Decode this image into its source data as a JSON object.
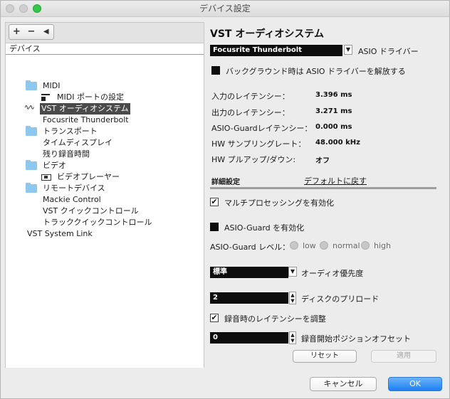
{
  "window": {
    "title": "デバイス設定"
  },
  "toolbar": {
    "add": "+",
    "remove": "−",
    "reset": "◀"
  },
  "tree": {
    "header": "デバイス",
    "items": [
      {
        "label": "MIDI"
      },
      {
        "label": "MIDI ポートの設定"
      },
      {
        "label": "VST オーディオシステム"
      },
      {
        "label": "Focusrite Thunderbolt"
      },
      {
        "label": "トランスポート"
      },
      {
        "label": "タイムディスプレイ"
      },
      {
        "label": "残り録音時間"
      },
      {
        "label": "ビデオ"
      },
      {
        "label": "ビデオプレーヤー"
      },
      {
        "label": "リモートデバイス"
      },
      {
        "label": "Mackie Control"
      },
      {
        "label": "VST クイックコントロール"
      },
      {
        "label": "トラッククイックコントロール"
      },
      {
        "label": "VST System Link"
      }
    ]
  },
  "panel": {
    "title": "VST オーディオシステム",
    "driver_value": "Focusrite Thunderbolt",
    "driver_label": "ASIO ドライバー",
    "background_release": "バックグラウンド時は ASIO ドライバーを解放する",
    "input_latency_label": "入力のレイテンシー：",
    "input_latency_value": "3.396 ms",
    "output_latency_label": "出力のレイテンシー：",
    "output_latency_value": "3.271 ms",
    "asio_guard_latency_label": "ASIO-Guardレイテンシー：",
    "asio_guard_latency_value": "0.000 ms",
    "sample_rate_label": "HW サンプリングレート：",
    "sample_rate_value": "48.000 kHz",
    "pullup_label": "HW プルアップ/ダウン:",
    "pullup_value": "オフ",
    "advanced_label": "詳細設定",
    "defaults_link": "デフォルトに戻す",
    "multiprocessing_label": "マルチプロセッシングを有効化",
    "asio_guard_enable_label": "ASIO-Guard を有効化",
    "asio_guard_level_label": "ASIO-Guard レベル：",
    "level_low": "low",
    "level_normal": "normal",
    "level_high": "high",
    "audio_priority_value": "標準",
    "audio_priority_label": "オーディオ優先度",
    "disk_preload_value": "2",
    "disk_preload_label": "ディスクのプリロード",
    "adjust_latency_label": "録音時のレイテンシーを調整",
    "record_offset_value": "0",
    "record_offset_label": "録音開始ポジションオフセット",
    "reset_button": "リセット",
    "apply_button": "適用"
  },
  "footer": {
    "cancel": "キャンセル",
    "ok": "OK"
  },
  "checks": {
    "checked_glyph": "✔"
  }
}
